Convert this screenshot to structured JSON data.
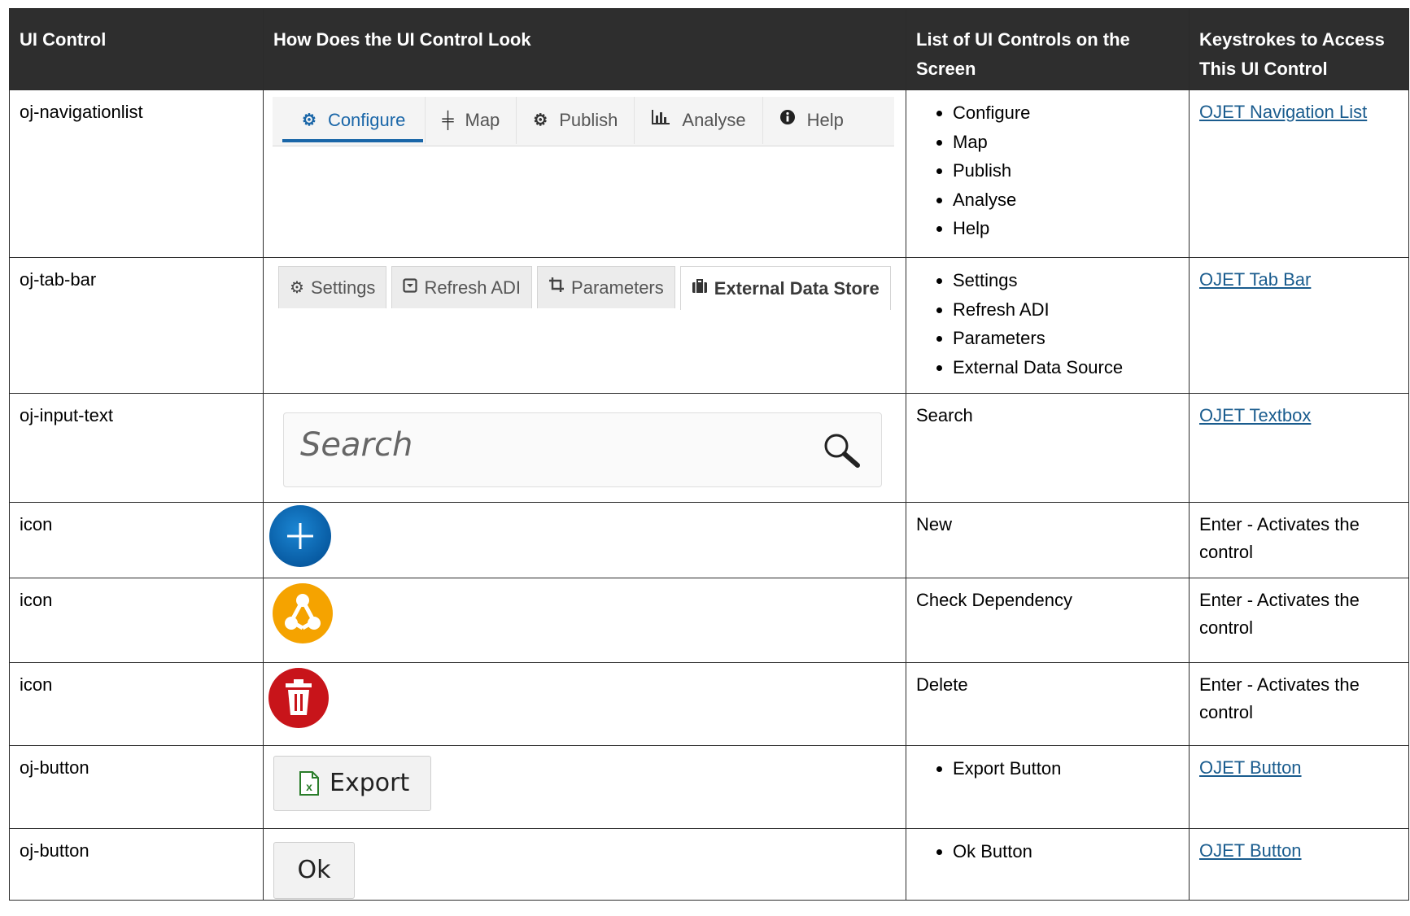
{
  "table": {
    "headers": [
      "UI Control",
      "How Does the UI Control Look",
      "List of UI Controls on the Screen",
      "Keystrokes to Access This UI Control"
    ],
    "rows": [
      {
        "control": "oj-navigationlist",
        "preview": {
          "items": [
            "Configure",
            "Map",
            "Publish",
            "Analyse",
            "Help"
          ],
          "selected": "Configure"
        },
        "list": [
          "Configure",
          "Map",
          "Publish",
          "Analyse",
          "Help"
        ],
        "keystroke_link": "OJET Navigation List"
      },
      {
        "control": "oj-tab-bar",
        "preview": {
          "tabs": [
            "Settings",
            "Refresh ADI",
            "Parameters",
            "External Data Store"
          ],
          "selected": "External Data Store"
        },
        "list": [
          "Settings",
          "Refresh ADI",
          "Parameters",
          "External Data Source"
        ],
        "keystroke_link": "OJET Tab Bar"
      },
      {
        "control": "oj-input-text",
        "preview": {
          "placeholder": "Search"
        },
        "list_text": "Search",
        "keystroke_link": "OJET Textbox"
      },
      {
        "control": "icon",
        "preview": {
          "icon": "plus-icon",
          "color": "#0a6fb8"
        },
        "list_text": "New",
        "keystroke_text": "Enter - Activates the control"
      },
      {
        "control": "icon",
        "preview": {
          "icon": "dependency-icon",
          "color": "#f5a300"
        },
        "list_text": "Check Dependency",
        "keystroke_text": "Enter - Activates the control"
      },
      {
        "control": "icon",
        "preview": {
          "icon": "trash-icon",
          "color": "#c8141a"
        },
        "list_text": "Delete",
        "keystroke_text": "Enter - Activates the control"
      },
      {
        "control": "oj-button",
        "preview": {
          "label": "Export",
          "icon": "excel-icon"
        },
        "list": [
          "Export Button"
        ],
        "keystroke_link": "OJET Button"
      },
      {
        "control": "oj-button",
        "preview": {
          "label": "Ok"
        },
        "list": [
          "Ok Button"
        ],
        "keystroke_link": "OJET Button"
      }
    ]
  }
}
